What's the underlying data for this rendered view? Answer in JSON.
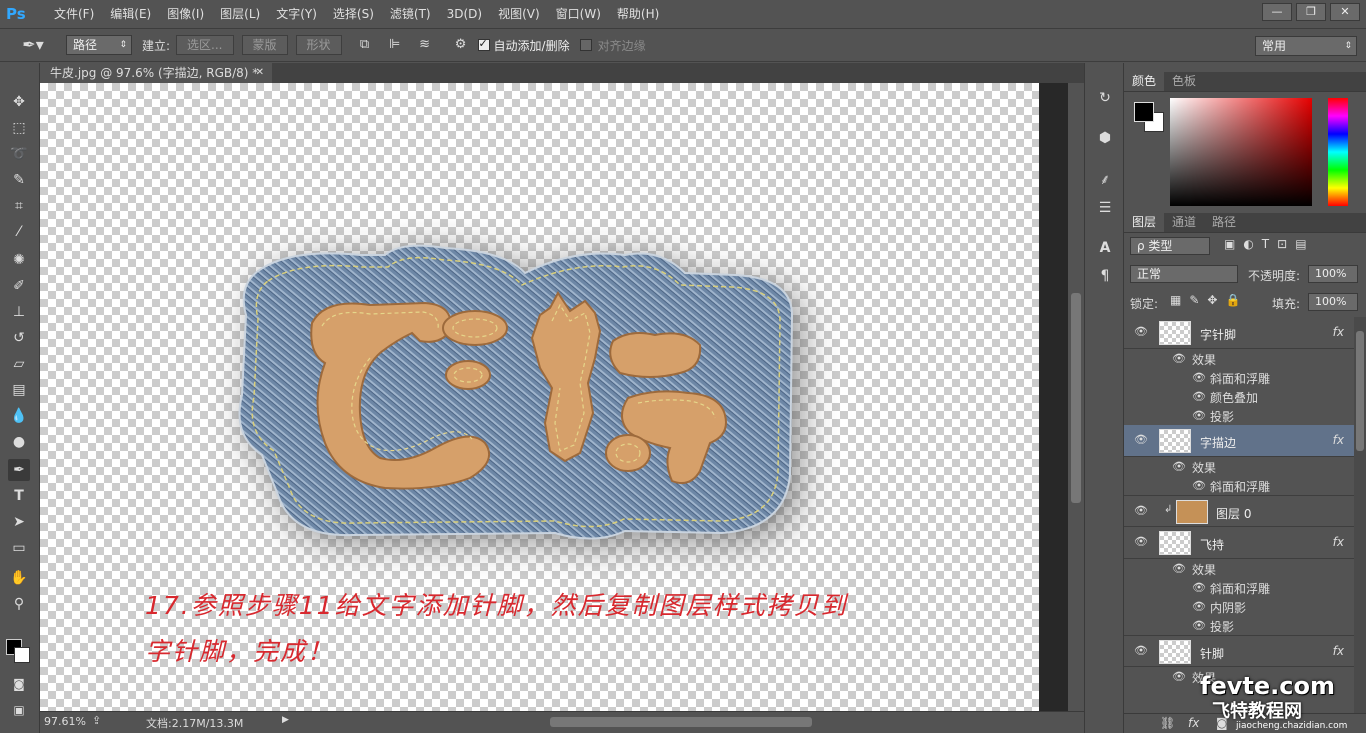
{
  "app": {
    "logo": "Ps"
  },
  "menu": [
    "文件(F)",
    "编辑(E)",
    "图像(I)",
    "图层(L)",
    "文字(Y)",
    "选择(S)",
    "滤镜(T)",
    "3D(D)",
    "视图(V)",
    "窗口(W)",
    "帮助(H)"
  ],
  "window_buttons": {
    "minimize": "—",
    "restore": "❐",
    "close": "✕"
  },
  "options": {
    "mode": "路径",
    "build_label": "建立:",
    "selection_btn": "选区...",
    "mask_btn": "蒙版",
    "shape_btn": "形状",
    "auto_add_label": "自动添加/删除",
    "auto_add_checked": true,
    "align_edges_label": "对齐边缘",
    "align_edges_checked": false,
    "workspace": "常用"
  },
  "document": {
    "tab_title": "牛皮.jpg @ 97.6% (字描边, RGB/8) *"
  },
  "canvas_text": {
    "logo_text": "飞特",
    "line1": "17.参照步骤11给文字添加针脚，然后复制图层样式拷贝到",
    "line2": "字针脚，完成！"
  },
  "status": {
    "zoom": "97.61%",
    "doc_info": "文档:2.17M/13.3M"
  },
  "color_panel": {
    "tabs": [
      "颜色",
      "色板"
    ],
    "foreground": "#000000",
    "background": "#ffffff"
  },
  "layers_panel": {
    "tabs": [
      "图层",
      "通道",
      "路径"
    ],
    "filter_kind": "ρ 类型",
    "blend_mode": "正常",
    "opacity_label": "不透明度:",
    "opacity": "100%",
    "lock_label": "锁定:",
    "fill_label": "填充:",
    "fill": "100%",
    "layers": [
      {
        "name": "字针脚",
        "fx": "fx",
        "effects_label": "效果",
        "effects": [
          "斜面和浮雕",
          "颜色叠加",
          "投影"
        ]
      },
      {
        "name": "字描边",
        "fx": "fx",
        "effects_label": "效果",
        "effects": [
          "斜面和浮雕"
        ]
      },
      {
        "name": "图层 0"
      },
      {
        "name": "飞持",
        "fx": "fx",
        "effects_label": "效果",
        "effects": [
          "斜面和浮雕",
          "内阴影",
          "投影"
        ]
      },
      {
        "name": "针脚",
        "fx": "fx",
        "effects_label": "效果"
      }
    ]
  },
  "watermark": {
    "line1": "fevte.com",
    "line2": "飞特教程网",
    "line3": "jiaocheng.chazidian.com"
  }
}
